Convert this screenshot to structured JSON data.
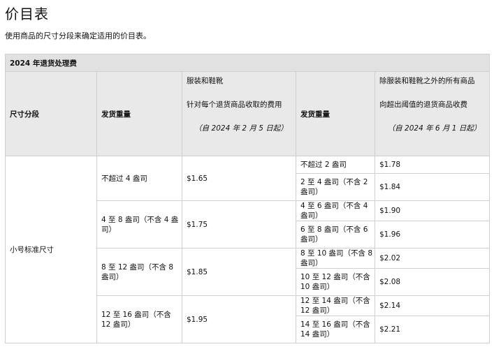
{
  "page": {
    "title": "价目表",
    "subtitle": "使用商品的尺寸分段来确定适用的价目表。"
  },
  "table": {
    "caption": "2024 年退货处理费",
    "headers": {
      "size_tier": "尺寸分段",
      "ship_weight_a": "发货重量",
      "apparel_title": "服装和鞋靴",
      "apparel_desc": "针对每个退货商品收取的费用",
      "apparel_date": "（自 2024 年 2 月 5 日起）",
      "ship_weight_b": "发货重量",
      "other_title": "除服装和鞋靴之外的所有商品",
      "other_desc": "向超出阈值的退货商品收费",
      "other_date": "（自 2024 年 6 月 1 日起）"
    },
    "tier": "小号标准尺寸",
    "groups": [
      {
        "weight": "不超过 4 盎司",
        "fee": "$1.65",
        "subs": [
          {
            "weight": "不超过 2 盎司",
            "fee": "$1.78"
          },
          {
            "weight": "2 至 4 盎司（不含 2 盎司）",
            "fee": "$1.84"
          }
        ]
      },
      {
        "weight": "4 至 8 盎司（不含 4 盎司）",
        "fee": "$1.75",
        "subs": [
          {
            "weight": "4 至 6 盎司（不含 4 盎司）",
            "fee": "$1.90"
          },
          {
            "weight": "6 至 8 盎司（不含 6 盎司）",
            "fee": "$1.96"
          }
        ]
      },
      {
        "weight": "8 至 12 盎司（不含 8 盎司）",
        "fee": "$1.85",
        "subs": [
          {
            "weight": "8 至 10 盎司（不含 8 盎司）",
            "fee": "$2.02"
          },
          {
            "weight": "10 至 12 盎司（不含 10 盎司）",
            "fee": "$2.08"
          }
        ]
      },
      {
        "weight": "12 至 16 盎司（不含 12 盎司）",
        "fee": "$1.95",
        "subs": [
          {
            "weight": "12 至 14 盎司（不含 12 盎司）",
            "fee": "$2.14"
          },
          {
            "weight": "14 至 16 盎司（不含 14 盎司）",
            "fee": "$2.21"
          }
        ]
      }
    ]
  }
}
